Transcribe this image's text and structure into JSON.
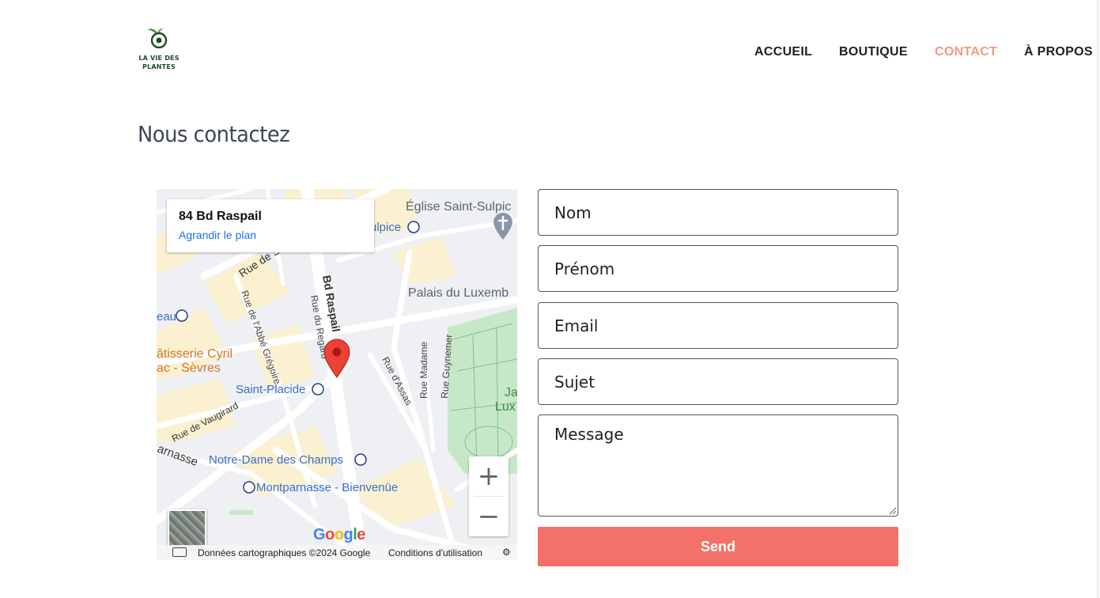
{
  "brand": {
    "logo_line1": "LA VIE DES",
    "logo_line2": "PLANTES",
    "colors": {
      "leaf": "#4a9a3a",
      "text": "#1d4a2a"
    }
  },
  "nav": {
    "items": [
      {
        "label": "ACCUEIL",
        "active": false
      },
      {
        "label": "BOUTIQUE",
        "active": false
      },
      {
        "label": "CONTACT",
        "active": true
      },
      {
        "label": "À PROPOS",
        "active": false
      }
    ],
    "active_color": "#f19a85"
  },
  "page": {
    "title": "Nous contactez"
  },
  "map": {
    "card_address": "84 Bd Raspail",
    "card_link": "Agrandir le plan",
    "labels": {
      "eglise": "Église Saint-Sulpic",
      "sulpice": "ulpice",
      "rue_se": "Rue de Sè",
      "bd_raspail": "Bd Raspail",
      "rue_regard": "Rue du Regard",
      "rue_abbe": "Rue de l'Abbé Grégoire",
      "palais": "Palais du Luxemb",
      "eau": "eau",
      "patisserie_1": "âtisserie Cyril",
      "patisserie_2": "ac - Sèvres",
      "saint_placide": "Saint-Placide",
      "rue_assas": "Rue d'Assas",
      "rue_madame": "Rue Madame",
      "rue_guynemer": "Rue Guynemer",
      "jardin_1": "Ja",
      "jardin_2": "Lux",
      "rue_vaugirard": "Rue de Vaugirard",
      "parnasse": "arnasse",
      "notre_dame": "Notre-Dame des Champs",
      "montparnasse": "Montparnasse - Bienvenüe"
    },
    "zoom_in": "+",
    "zoom_out": "−",
    "google": "Google",
    "attribution": "Données cartographiques ©2024 Google",
    "terms": "Conditions d'utilisation",
    "marker_color": "#ea4335"
  },
  "form": {
    "nom_placeholder": "Nom",
    "prenom_placeholder": "Prénom",
    "email_placeholder": "Email",
    "sujet_placeholder": "Sujet",
    "message_placeholder": "Message",
    "send_label": "Send",
    "send_color": "#f4706a"
  }
}
